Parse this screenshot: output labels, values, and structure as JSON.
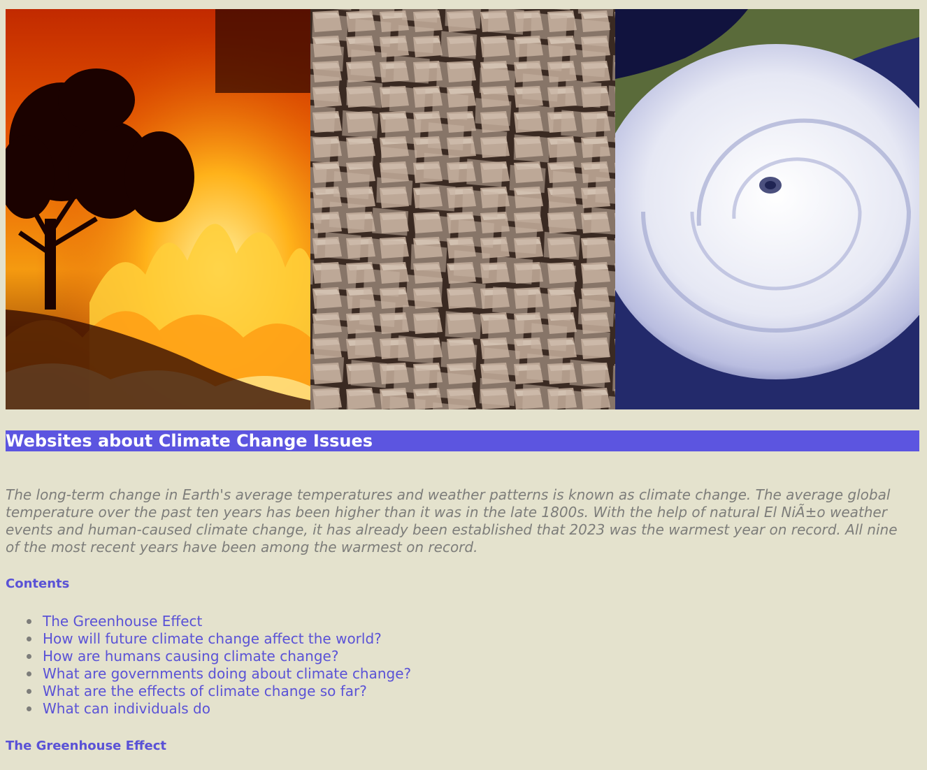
{
  "banner": {
    "panels": [
      {
        "name": "wildfire"
      },
      {
        "name": "cracked-dry-earth"
      },
      {
        "name": "hurricane-satellite"
      }
    ]
  },
  "heading": {
    "title": "Websites about Climate Change Issues"
  },
  "intro": {
    "text": "The long-term change in Earth's average temperatures and weather patterns is known as climate change. The average global temperature over the past ten years has been higher than it was in the late 1800s. With the help of natural El NiÃ±o weather events and human-caused climate change, it has already been established that 2023 was the warmest year on record. All nine of the most recent years have been among the warmest on record."
  },
  "contents": {
    "heading": "Contents",
    "items": [
      {
        "label": "The Greenhouse Effect"
      },
      {
        "label": "How will future climate change affect the world?"
      },
      {
        "label": "How are humans causing climate change?"
      },
      {
        "label": "What are governments doing about climate change?"
      },
      {
        "label": "What are the effects of climate change so far?"
      },
      {
        "label": "What can individuals do"
      }
    ]
  },
  "section": {
    "greenhouse_heading": "The Greenhouse Effect"
  },
  "colors": {
    "background": "#e4e2cd",
    "title_bar": "#5c55e0",
    "accent_text": "#5a52d6",
    "body_text": "#7d7d7a"
  }
}
